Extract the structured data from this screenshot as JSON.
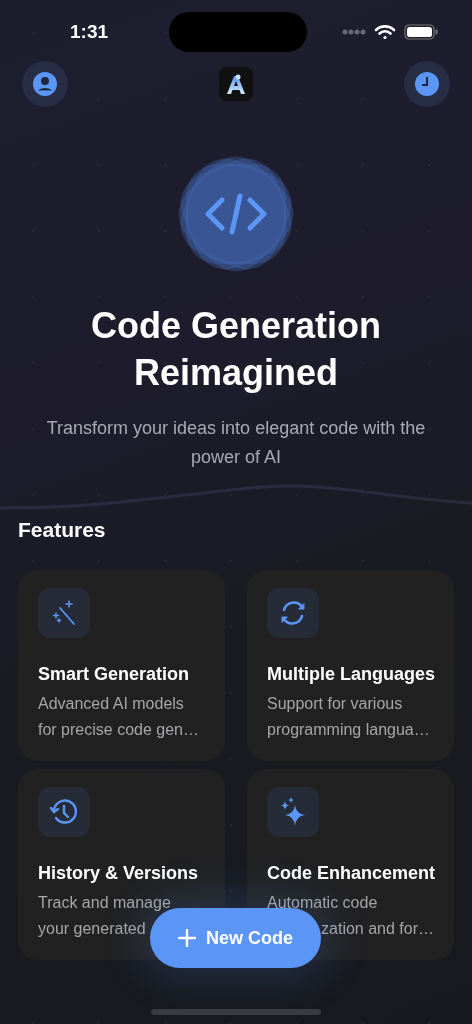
{
  "status_bar": {
    "time": "1:31"
  },
  "hero": {
    "title": "Code Generation Reimagined",
    "subtitle": "Transform your ideas into elegant code with the power of AI"
  },
  "features": {
    "heading": "Features",
    "items": [
      {
        "kind": "wand",
        "title": "Smart Generation",
        "lines": [
          {
            "text": "Advanced AI models"
          },
          {
            "text": "for precise code gen…"
          }
        ]
      },
      {
        "kind": "sync",
        "title": "Multiple Languages",
        "lines": [
          {
            "text": "Support for various"
          },
          {
            "text": "programming langua…"
          }
        ]
      },
      {
        "kind": "history",
        "title": "History & Versions",
        "lines": [
          {
            "text": "Track and manage"
          },
          {
            "text": "your generated"
          }
        ]
      },
      {
        "kind": "sparkle",
        "title": "Code Enhancement",
        "lines": [
          {
            "text": "Automatic code"
          },
          {
            "text": "zation and for…",
            "partly_hidden": true
          }
        ]
      }
    ]
  },
  "action_button": {
    "label": "New Code"
  }
}
